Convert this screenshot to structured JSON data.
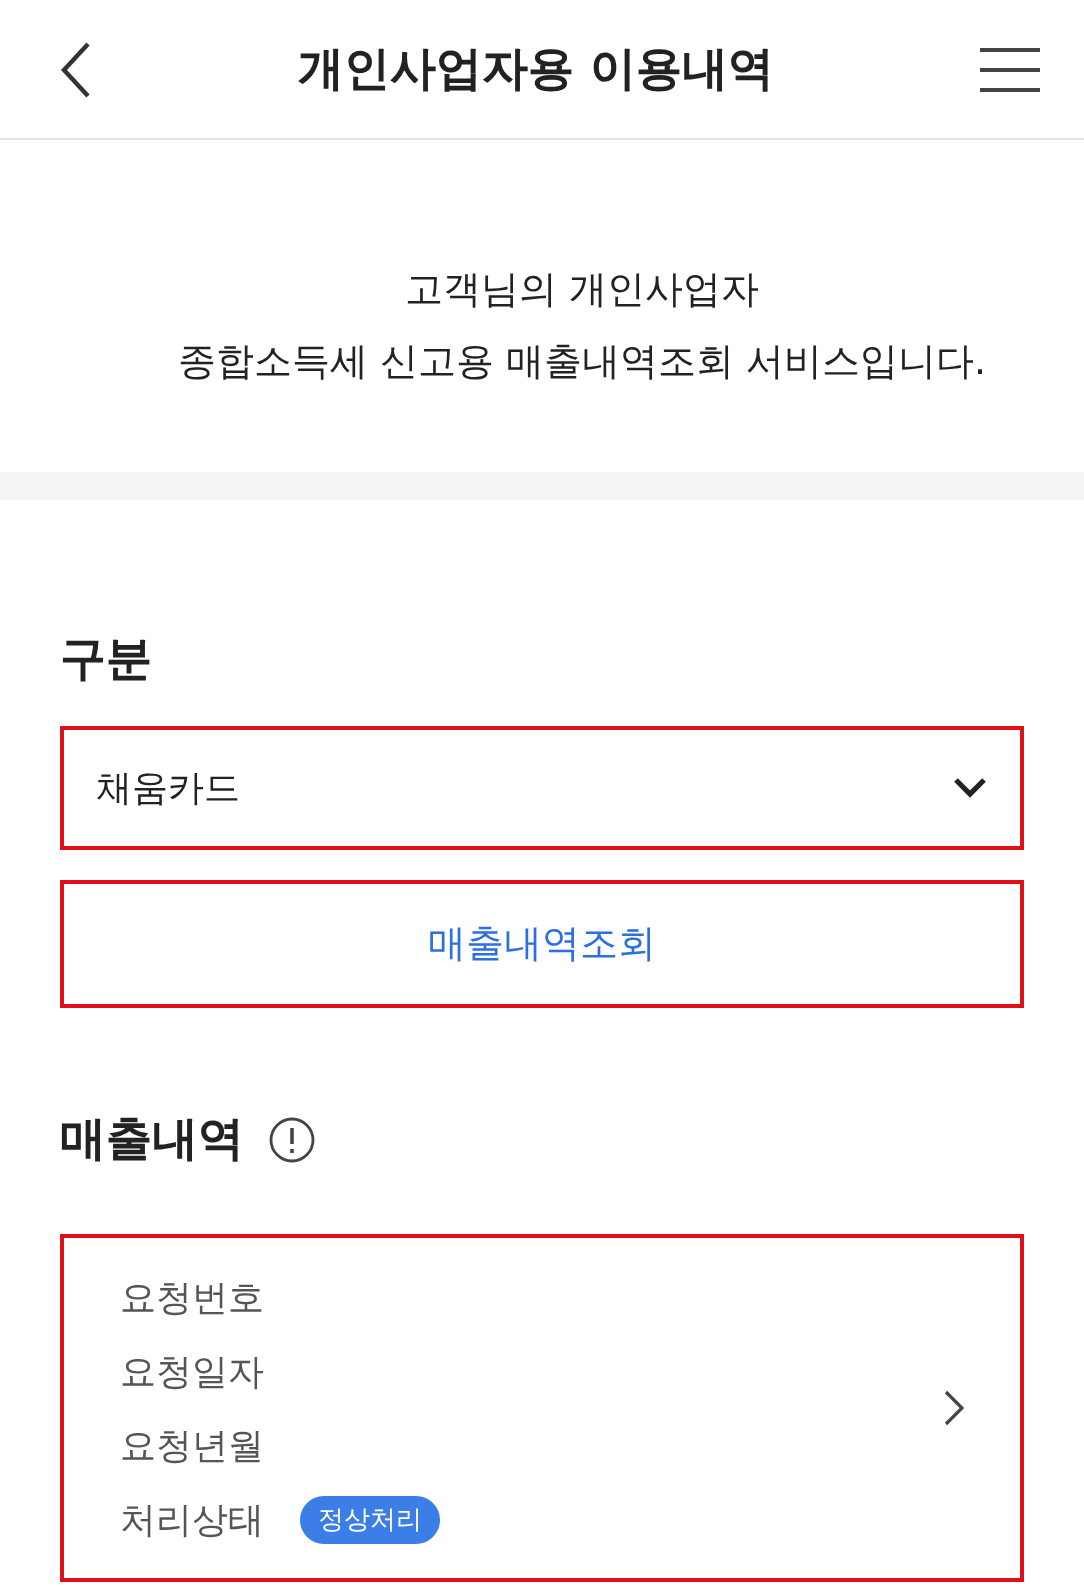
{
  "header": {
    "title": "개인사업자용 이용내역"
  },
  "intro": [
    "고객님의 개인사업자",
    "종합소득세 신고용 매출내역조회 서비스입니다."
  ],
  "category": {
    "label": "구분",
    "value": "채움카드"
  },
  "query_button": "매출내역조회",
  "sales": {
    "title": "매출내역",
    "rows": [
      {
        "label": "요청번호"
      },
      {
        "label": "요청일자"
      },
      {
        "label": "요청년월"
      },
      {
        "label": "처리상태",
        "badge": "정상처리"
      }
    ]
  }
}
